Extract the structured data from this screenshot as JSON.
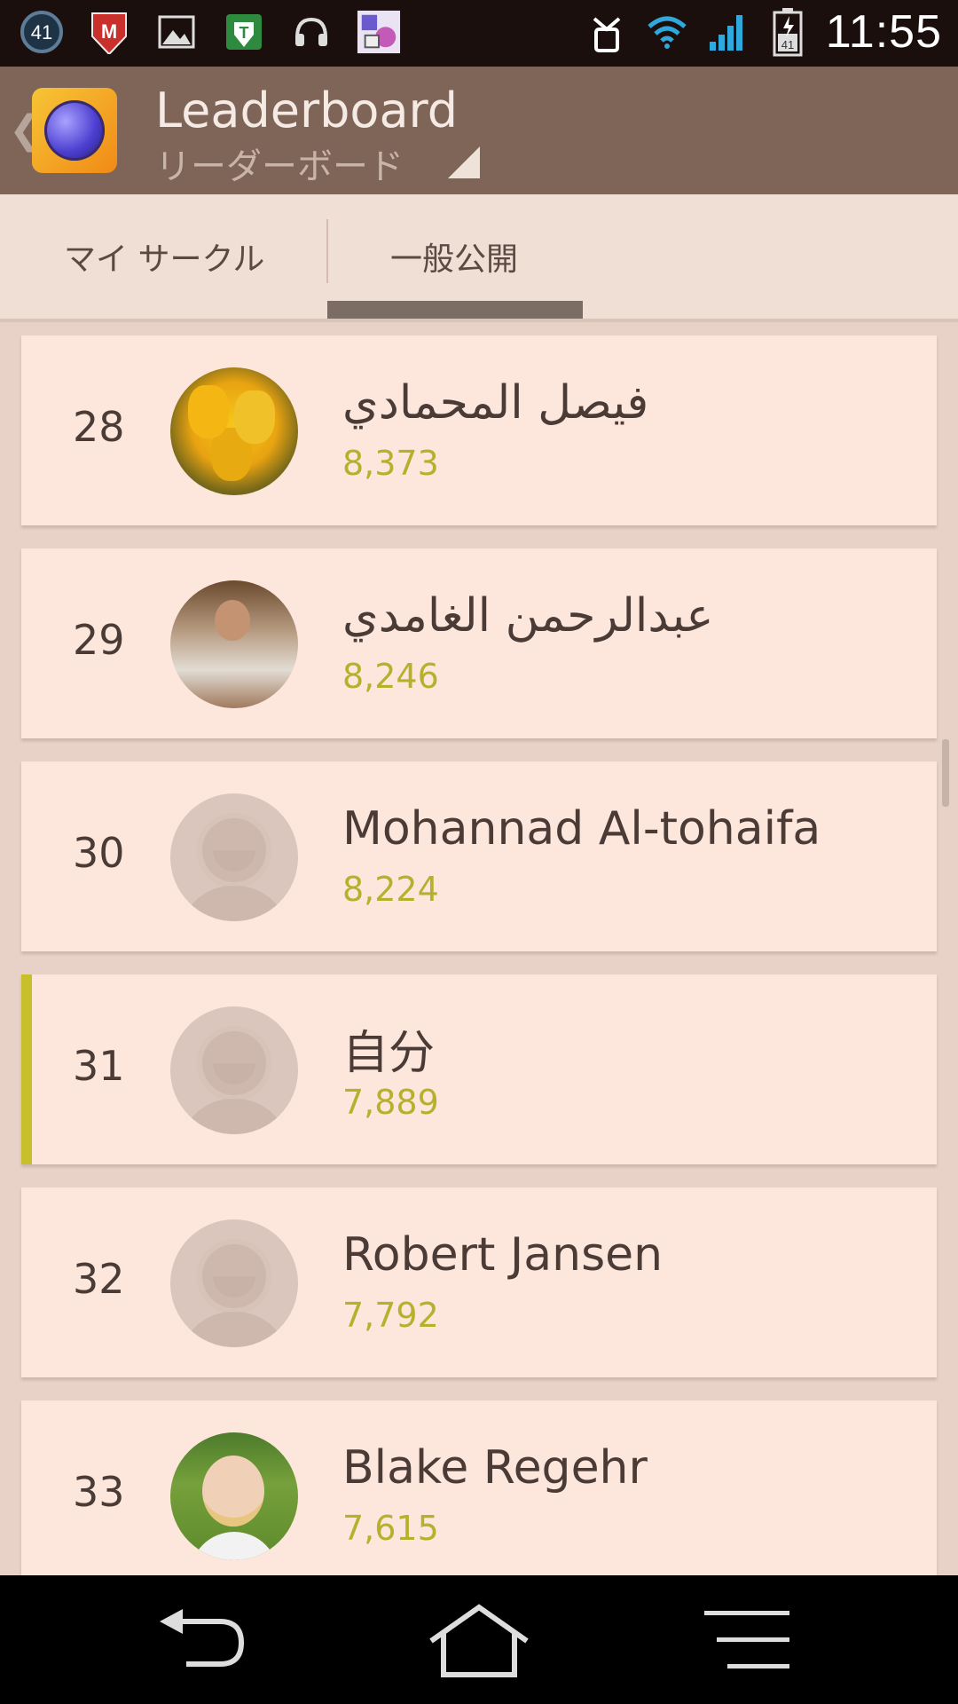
{
  "status_bar": {
    "notification_badge": "41",
    "battery_level": "41",
    "time": "11:55",
    "icons": [
      "notification-count-icon",
      "mcafee-icon",
      "gallery-icon",
      "shield-icon",
      "headset-icon",
      "game-thumbnail-icon",
      "alarm-icon",
      "wifi-icon",
      "signal-icon",
      "battery-icon"
    ]
  },
  "action_bar": {
    "title": "Leaderboard",
    "subtitle": "リーダーボード"
  },
  "tabs": [
    {
      "label": "マイ サークル",
      "selected": false
    },
    {
      "label": "一般公開",
      "selected": true
    }
  ],
  "leaderboard": {
    "rows": [
      {
        "rank": "28",
        "name": "فيصل المحمادي",
        "score": "8,373",
        "avatar": "tulips-photo"
      },
      {
        "rank": "29",
        "name": "عبدالرحمن الغامدي",
        "score": "8,246",
        "avatar": "man-photo"
      },
      {
        "rank": "30",
        "name": "Mohannad Al-tohaifa",
        "score": "8,224",
        "avatar": "default-avatar"
      },
      {
        "rank": "31",
        "name": "自分",
        "score": "7,889",
        "avatar": "default-avatar",
        "is_me": true
      },
      {
        "rank": "32",
        "name": "Robert Jansen",
        "score": "7,792",
        "avatar": "default-avatar"
      },
      {
        "rank": "33",
        "name": "Blake Regehr",
        "score": "7,615",
        "avatar": "boy-photo"
      }
    ]
  },
  "colors": {
    "action_bar": "#7e6558",
    "row_background": "#fde6dc",
    "score_text": "#b7b02c",
    "me_highlight": "#c7bf2b"
  }
}
